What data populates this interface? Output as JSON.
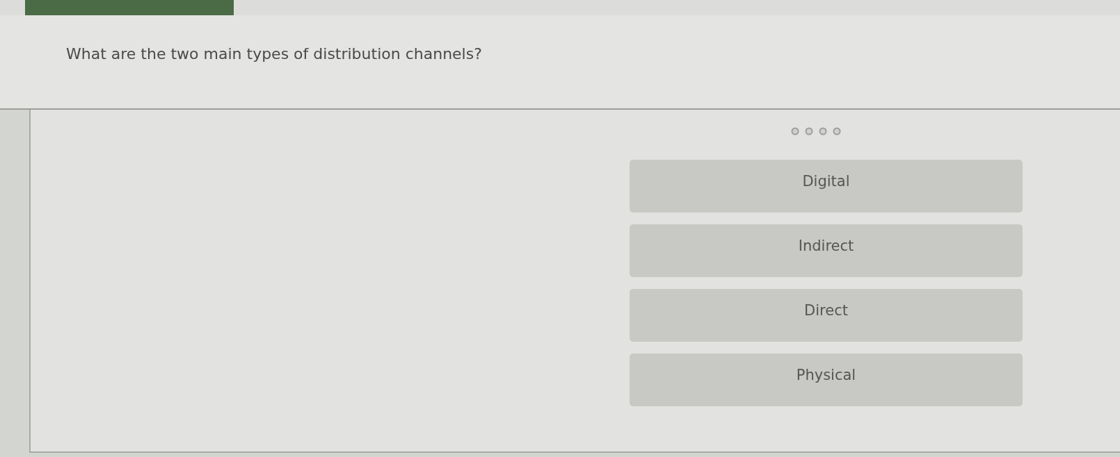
{
  "question": {
    "text": "What are the two main types of distribution channels?"
  },
  "answers": [
    {
      "label": "Digital",
      "selected": false
    },
    {
      "label": "Indirect",
      "selected": false
    },
    {
      "label": "Direct",
      "selected": false
    },
    {
      "label": "Physical",
      "selected": false
    }
  ]
}
